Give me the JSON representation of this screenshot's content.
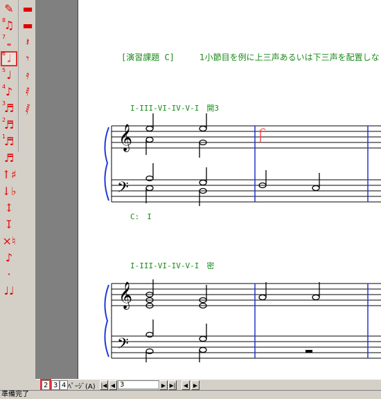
{
  "palette": {
    "col1": [
      {
        "name": "eraser-icon",
        "glyph": "✎"
      },
      {
        "name": "note-8th-group-icon",
        "glyph": "♫",
        "dur": "8"
      },
      {
        "name": "whole-note-icon",
        "glyph": "𝅝",
        "dur": "7"
      },
      {
        "name": "half-note-icon",
        "glyph": "𝅗𝅥",
        "dur": "6",
        "selected": true
      },
      {
        "name": "quarter-note-icon",
        "glyph": "♩",
        "dur": "5"
      },
      {
        "name": "eighth-note-icon",
        "glyph": "♪",
        "dur": "4"
      },
      {
        "name": "sixteenth-note-icon",
        "glyph": "♬",
        "dur": "3"
      },
      {
        "name": "thirty-second-note-icon",
        "glyph": "♬",
        "dur": "2"
      },
      {
        "name": "sixty-fourth-note-icon",
        "glyph": "♬",
        "dur": "1"
      },
      {
        "name": "note-128-icon",
        "glyph": "♬"
      },
      {
        "name": "sharp-up-icon",
        "glyph": "↑♯"
      },
      {
        "name": "flat-down-icon",
        "glyph": "↓♭"
      },
      {
        "name": "pitch-up-down-icon",
        "glyph": "↕"
      },
      {
        "name": "pitch-down-icon",
        "glyph": "↧"
      },
      {
        "name": "natural-icon",
        "glyph": "×♮"
      },
      {
        "name": "grace-note-icon",
        "glyph": "♪"
      },
      {
        "name": "dot-icon",
        "glyph": "·"
      },
      {
        "name": "tie-icon",
        "glyph": "♩♩"
      }
    ],
    "col2": [
      {
        "name": "whole-rest-icon",
        "glyph": "▬"
      },
      {
        "name": "half-rest-icon",
        "glyph": "▬"
      },
      {
        "name": "quarter-rest-icon",
        "glyph": "𝄽"
      },
      {
        "name": "eighth-rest-icon",
        "glyph": "𝄾"
      },
      {
        "name": "sixteenth-rest-icon",
        "glyph": "𝄿"
      },
      {
        "name": "thirty-second-rest-icon",
        "glyph": "𝅀"
      },
      {
        "name": "sixty-fourth-rest-icon",
        "glyph": "𝅁"
      }
    ]
  },
  "score": {
    "exercise_heading": "[演習課題 C]",
    "instruction": "1小節目を例に上三声あるいは下三声を配置しな",
    "system1_progression": "I-III-VI-IV-V-I　開3",
    "system1_key": "C:　I",
    "system2_progression": "I-III-VI-IV-V-I　密"
  },
  "navbar": {
    "page2": "2",
    "page3": "3",
    "page4": "4",
    "page_label": "ﾍﾟｰｼﾞ(A)",
    "page_input": "3"
  },
  "status": "準備完了"
}
